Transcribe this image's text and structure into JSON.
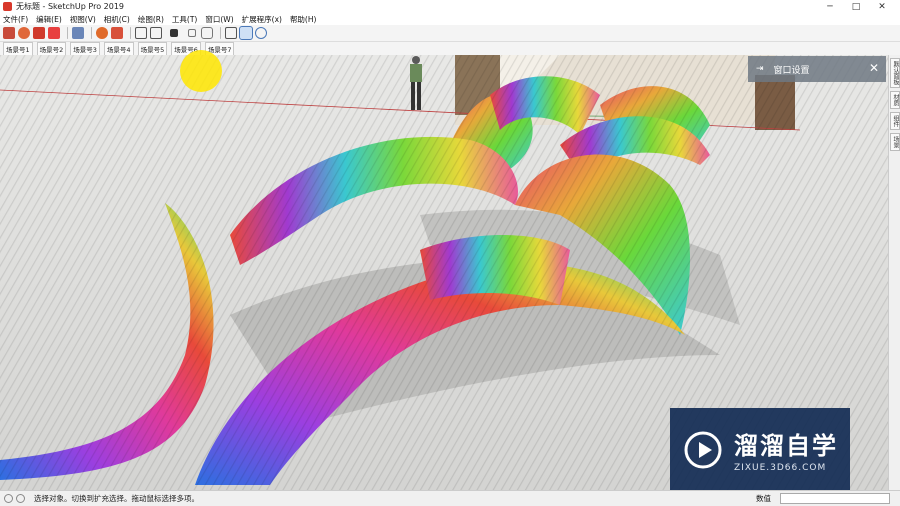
{
  "window": {
    "title": "无标题 - SketchUp Pro 2019",
    "controls": [
      "─",
      "□",
      "✕"
    ]
  },
  "menu": [
    "文件(F)",
    "编辑(E)",
    "视图(V)",
    "相机(C)",
    "绘图(R)",
    "工具(T)",
    "窗口(W)",
    "扩展程序(x)",
    "帮助(H)"
  ],
  "toolbar": {
    "icons": [
      "eraser-icon",
      "paint-icon",
      "folder-icon",
      "camera-icon",
      "lock-icon",
      "gear-icon",
      "house-icon",
      "view-front-icon",
      "view-back-icon",
      "view-top-icon",
      "view-left-icon",
      "view-right-icon",
      "zoom-icon",
      "tag-icon",
      "section-icon"
    ]
  },
  "scenes": [
    "场景号1",
    "场景号2",
    "场景号3",
    "场景号4",
    "场景号5",
    "场景号6",
    "场景号7"
  ],
  "panel": {
    "title": "窗口设置",
    "close": "✕"
  },
  "right_strip": [
    "默认面板",
    "材质",
    "组件",
    "场景"
  ],
  "status": {
    "text": "选择对象。切换到扩充选择。拖动鼠标选择多项。",
    "measure_label": "数值",
    "measure_value": ""
  },
  "watermark": {
    "name": "溜溜自学",
    "url": "ZIXUE.3D66.COM"
  }
}
